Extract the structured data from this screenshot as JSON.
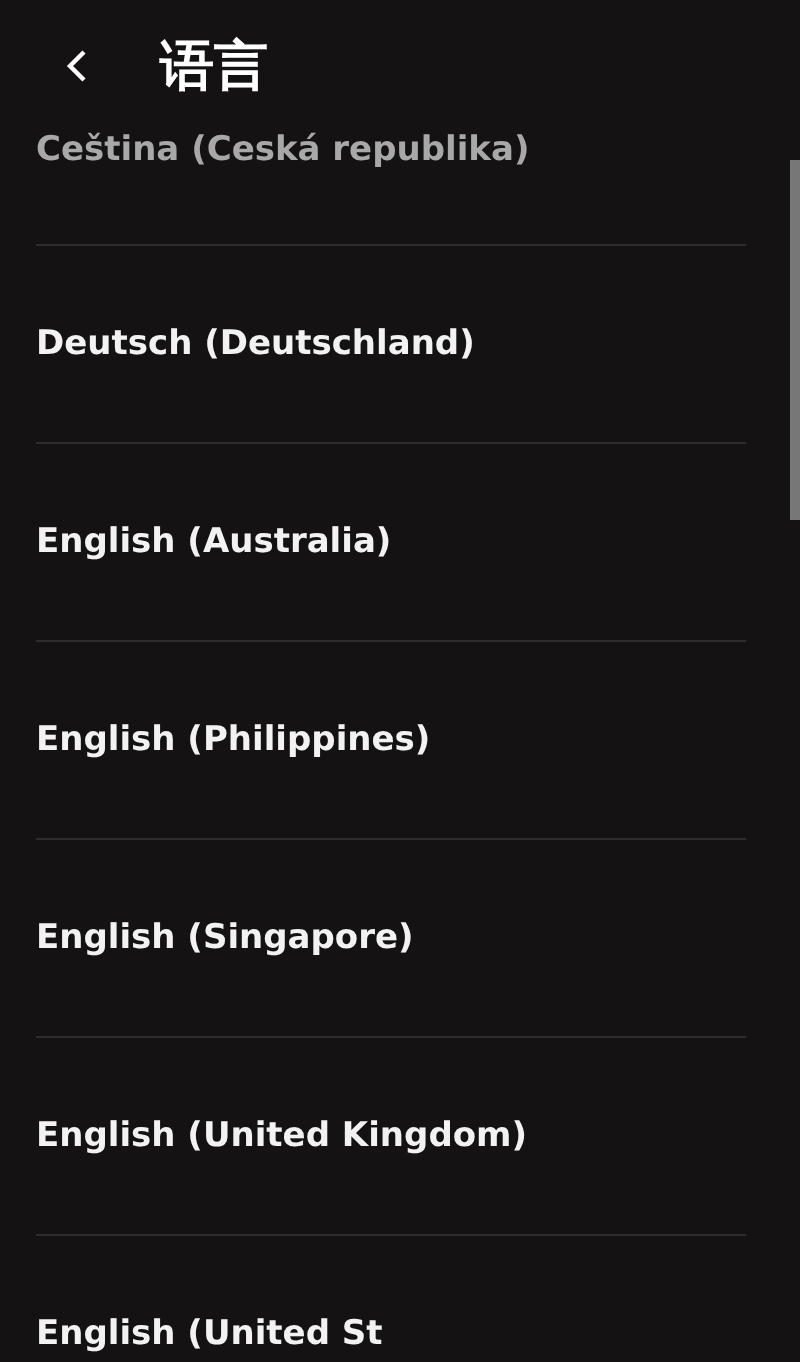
{
  "header": {
    "title": "语言"
  },
  "languages": [
    {
      "label": "Ceština (Ceská republika)",
      "dimmed": true
    },
    {
      "label": "Deutsch (Deutschland)",
      "dimmed": false
    },
    {
      "label": "English (Australia)",
      "dimmed": false
    },
    {
      "label": "English (Philippines)",
      "dimmed": false
    },
    {
      "label": "English (Singapore)",
      "dimmed": false
    },
    {
      "label": "English (United Kingdom)",
      "dimmed": false
    },
    {
      "label": "English (United St",
      "dimmed": false
    }
  ]
}
